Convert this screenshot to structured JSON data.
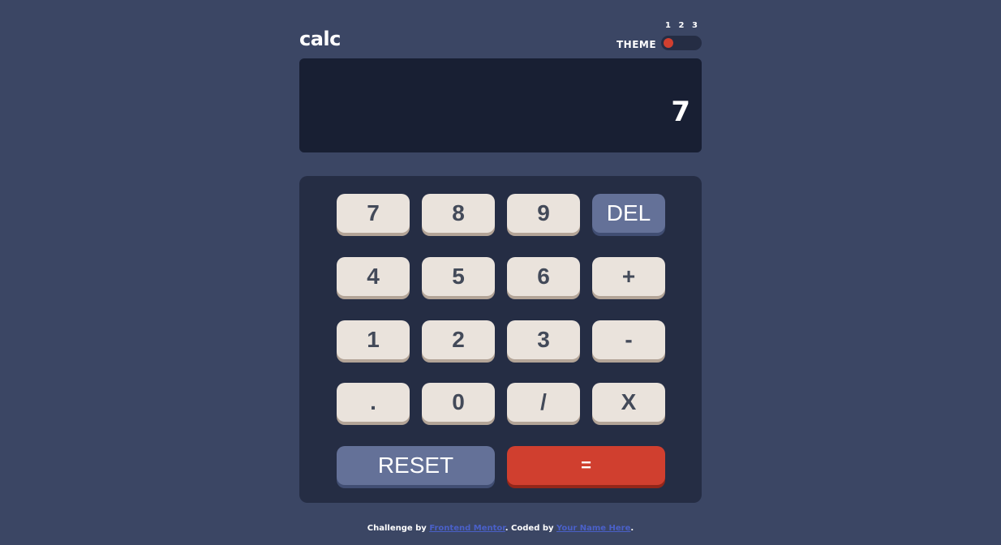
{
  "header": {
    "logo": "calc",
    "theme_label": "THEME",
    "theme_options": [
      "1",
      "2",
      "3"
    ],
    "selected_theme": "1"
  },
  "display": {
    "value": "7"
  },
  "keypad": {
    "rows": [
      [
        "7",
        "8",
        "9",
        "DEL"
      ],
      [
        "4",
        "5",
        "6",
        "+"
      ],
      [
        "1",
        "2",
        "3",
        "-"
      ],
      [
        ".",
        "0",
        "/",
        "X"
      ]
    ],
    "reset_label": "RESET",
    "equals_label": "="
  },
  "footer": {
    "prefix": "Challenge by ",
    "link1": "Frontend Mentor",
    "middle": ". Coded by ",
    "link2": "Your Name Here",
    "suffix": "."
  },
  "colors": {
    "background": "#3b4664",
    "keypad_bg": "#252d44",
    "screen_bg": "#181f33",
    "key_bg": "#eae3dc",
    "key_accent": "#647198",
    "equals_bg": "#d03f2f"
  }
}
